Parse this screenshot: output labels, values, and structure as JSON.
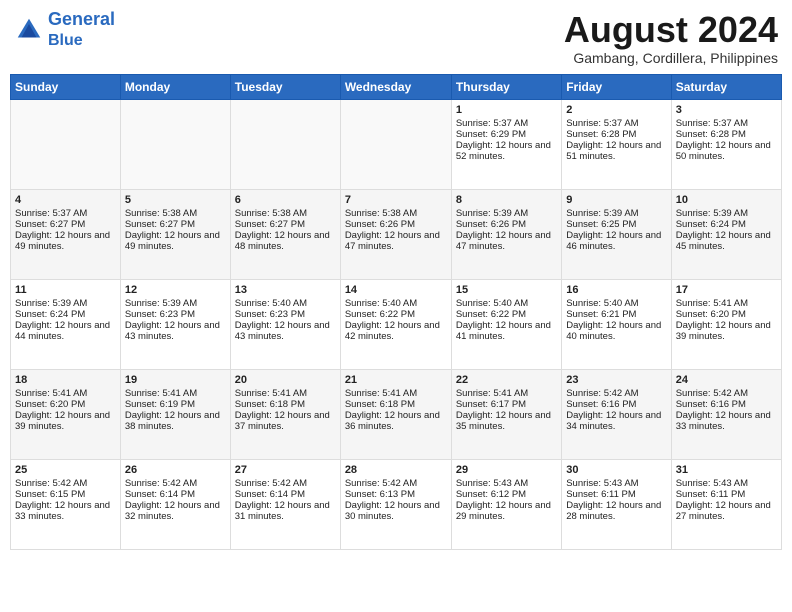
{
  "header": {
    "logo_line1": "General",
    "logo_line2": "Blue",
    "month_year": "August 2024",
    "location": "Gambang, Cordillera, Philippines"
  },
  "days_of_week": [
    "Sunday",
    "Monday",
    "Tuesday",
    "Wednesday",
    "Thursday",
    "Friday",
    "Saturday"
  ],
  "weeks": [
    [
      {
        "day": "",
        "sunrise": "",
        "sunset": "",
        "daylight": ""
      },
      {
        "day": "",
        "sunrise": "",
        "sunset": "",
        "daylight": ""
      },
      {
        "day": "",
        "sunrise": "",
        "sunset": "",
        "daylight": ""
      },
      {
        "day": "",
        "sunrise": "",
        "sunset": "",
        "daylight": ""
      },
      {
        "day": "1",
        "sunrise": "5:37 AM",
        "sunset": "6:29 PM",
        "daylight": "12 hours and 52 minutes."
      },
      {
        "day": "2",
        "sunrise": "5:37 AM",
        "sunset": "6:28 PM",
        "daylight": "12 hours and 51 minutes."
      },
      {
        "day": "3",
        "sunrise": "5:37 AM",
        "sunset": "6:28 PM",
        "daylight": "12 hours and 50 minutes."
      }
    ],
    [
      {
        "day": "4",
        "sunrise": "5:37 AM",
        "sunset": "6:27 PM",
        "daylight": "12 hours and 49 minutes."
      },
      {
        "day": "5",
        "sunrise": "5:38 AM",
        "sunset": "6:27 PM",
        "daylight": "12 hours and 49 minutes."
      },
      {
        "day": "6",
        "sunrise": "5:38 AM",
        "sunset": "6:27 PM",
        "daylight": "12 hours and 48 minutes."
      },
      {
        "day": "7",
        "sunrise": "5:38 AM",
        "sunset": "6:26 PM",
        "daylight": "12 hours and 47 minutes."
      },
      {
        "day": "8",
        "sunrise": "5:39 AM",
        "sunset": "6:26 PM",
        "daylight": "12 hours and 47 minutes."
      },
      {
        "day": "9",
        "sunrise": "5:39 AM",
        "sunset": "6:25 PM",
        "daylight": "12 hours and 46 minutes."
      },
      {
        "day": "10",
        "sunrise": "5:39 AM",
        "sunset": "6:24 PM",
        "daylight": "12 hours and 45 minutes."
      }
    ],
    [
      {
        "day": "11",
        "sunrise": "5:39 AM",
        "sunset": "6:24 PM",
        "daylight": "12 hours and 44 minutes."
      },
      {
        "day": "12",
        "sunrise": "5:39 AM",
        "sunset": "6:23 PM",
        "daylight": "12 hours and 43 minutes."
      },
      {
        "day": "13",
        "sunrise": "5:40 AM",
        "sunset": "6:23 PM",
        "daylight": "12 hours and 43 minutes."
      },
      {
        "day": "14",
        "sunrise": "5:40 AM",
        "sunset": "6:22 PM",
        "daylight": "12 hours and 42 minutes."
      },
      {
        "day": "15",
        "sunrise": "5:40 AM",
        "sunset": "6:22 PM",
        "daylight": "12 hours and 41 minutes."
      },
      {
        "day": "16",
        "sunrise": "5:40 AM",
        "sunset": "6:21 PM",
        "daylight": "12 hours and 40 minutes."
      },
      {
        "day": "17",
        "sunrise": "5:41 AM",
        "sunset": "6:20 PM",
        "daylight": "12 hours and 39 minutes."
      }
    ],
    [
      {
        "day": "18",
        "sunrise": "5:41 AM",
        "sunset": "6:20 PM",
        "daylight": "12 hours and 39 minutes."
      },
      {
        "day": "19",
        "sunrise": "5:41 AM",
        "sunset": "6:19 PM",
        "daylight": "12 hours and 38 minutes."
      },
      {
        "day": "20",
        "sunrise": "5:41 AM",
        "sunset": "6:18 PM",
        "daylight": "12 hours and 37 minutes."
      },
      {
        "day": "21",
        "sunrise": "5:41 AM",
        "sunset": "6:18 PM",
        "daylight": "12 hours and 36 minutes."
      },
      {
        "day": "22",
        "sunrise": "5:41 AM",
        "sunset": "6:17 PM",
        "daylight": "12 hours and 35 minutes."
      },
      {
        "day": "23",
        "sunrise": "5:42 AM",
        "sunset": "6:16 PM",
        "daylight": "12 hours and 34 minutes."
      },
      {
        "day": "24",
        "sunrise": "5:42 AM",
        "sunset": "6:16 PM",
        "daylight": "12 hours and 33 minutes."
      }
    ],
    [
      {
        "day": "25",
        "sunrise": "5:42 AM",
        "sunset": "6:15 PM",
        "daylight": "12 hours and 33 minutes."
      },
      {
        "day": "26",
        "sunrise": "5:42 AM",
        "sunset": "6:14 PM",
        "daylight": "12 hours and 32 minutes."
      },
      {
        "day": "27",
        "sunrise": "5:42 AM",
        "sunset": "6:14 PM",
        "daylight": "12 hours and 31 minutes."
      },
      {
        "day": "28",
        "sunrise": "5:42 AM",
        "sunset": "6:13 PM",
        "daylight": "12 hours and 30 minutes."
      },
      {
        "day": "29",
        "sunrise": "5:43 AM",
        "sunset": "6:12 PM",
        "daylight": "12 hours and 29 minutes."
      },
      {
        "day": "30",
        "sunrise": "5:43 AM",
        "sunset": "6:11 PM",
        "daylight": "12 hours and 28 minutes."
      },
      {
        "day": "31",
        "sunrise": "5:43 AM",
        "sunset": "6:11 PM",
        "daylight": "12 hours and 27 minutes."
      }
    ]
  ]
}
